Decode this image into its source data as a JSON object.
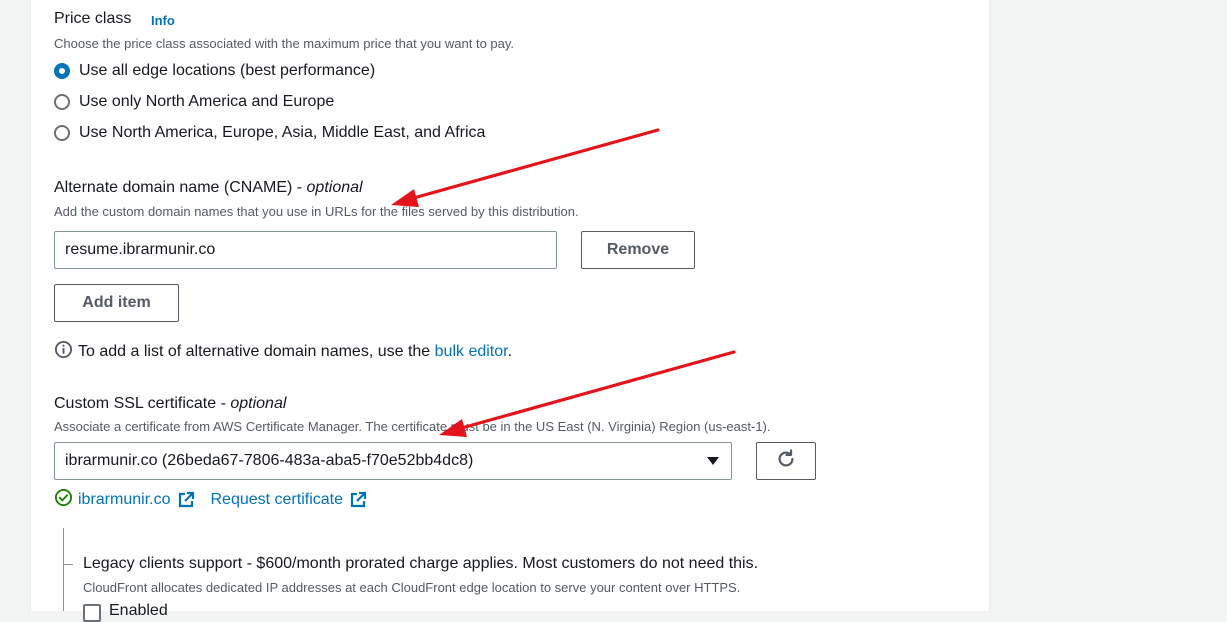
{
  "price_class": {
    "label": "Price class",
    "info": "Info",
    "description": "Choose the price class associated with the maximum price that you want to pay.",
    "options": [
      {
        "label": "Use all edge locations (best performance)",
        "selected": true
      },
      {
        "label": "Use only North America and Europe",
        "selected": false
      },
      {
        "label": "Use North America, Europe, Asia, Middle East, and Africa",
        "selected": false
      }
    ]
  },
  "cname": {
    "label": "Alternate domain name (CNAME) - ",
    "optional": "optional",
    "description": "Add the custom domain names that you use in URLs for the files served by this distribution.",
    "value": "resume.ibrarmunir.co",
    "remove_label": "Remove",
    "add_item_label": "Add item",
    "hint_prefix": "To add a list of alternative domain names, use the ",
    "hint_link": "bulk editor",
    "hint_suffix": "."
  },
  "ssl": {
    "label": "Custom SSL certificate - ",
    "optional": "optional",
    "description": "Associate a certificate from AWS Certificate Manager. The certificate must be in the US East (N. Virginia) Region (us-east-1).",
    "selected": "ibrarmunir.co (26beda67-7806-483a-aba5-f70e52bb4dc8)",
    "status_link": "ibrarmunir.co",
    "request_link": "Request certificate"
  },
  "legacy": {
    "label": "Legacy clients support - $600/month prorated charge applies. Most customers do not need this.",
    "description": "CloudFront allocates dedicated IP addresses at each CloudFront edge location to serve your content over HTTPS.",
    "checkbox_label": "Enabled"
  },
  "colors": {
    "accent": "#0073bb",
    "success": "#1d8102",
    "annotation_arrow": "#e3141b"
  }
}
